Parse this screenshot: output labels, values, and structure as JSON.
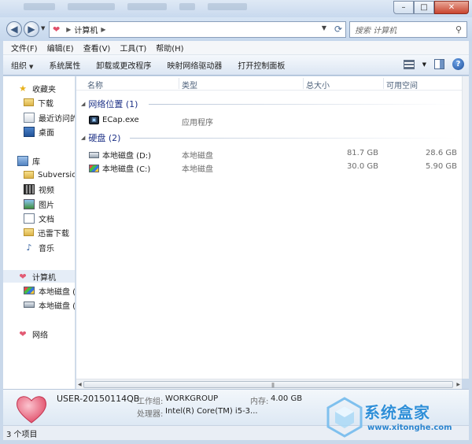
{
  "address": {
    "location": "计算机",
    "search_placeholder": "搜索 计算机"
  },
  "menu": [
    "文件(F)",
    "编辑(E)",
    "查看(V)",
    "工具(T)",
    "帮助(H)"
  ],
  "toolbar": {
    "organize": "组织",
    "system_properties": "系统属性",
    "uninstall": "卸载或更改程序",
    "map_drive": "映射网络驱动器",
    "control_panel": "打开控制面板"
  },
  "nav": {
    "favorites": "收藏夹",
    "downloads": "下载",
    "recent": "最近访问的",
    "desktop": "桌面",
    "libraries": "库",
    "subversion": "Subversion",
    "videos": "视频",
    "pictures": "图片",
    "documents": "文档",
    "thunder": "迅雷下载",
    "music": "音乐",
    "computer": "计算机",
    "disk_c": "本地磁盘 (C",
    "disk_d": "本地磁盘 (D",
    "network": "网络"
  },
  "columns": {
    "name": "名称",
    "type": "类型",
    "total": "总大小",
    "free": "可用空间"
  },
  "groups": {
    "network": {
      "header": "网络位置 (1)",
      "items": [
        {
          "name": "ECap.exe",
          "type": "应用程序",
          "total": "",
          "free": ""
        }
      ]
    },
    "disks": {
      "header": "硬盘 (2)",
      "items": [
        {
          "name": "本地磁盘 (D:)",
          "type": "本地磁盘",
          "total": "81.7 GB",
          "free": "28.6 GB"
        },
        {
          "name": "本地磁盘 (C:)",
          "type": "本地磁盘",
          "total": "30.0 GB",
          "free": "5.90 GB"
        }
      ]
    }
  },
  "details": {
    "computer_name": "USER-20150114QB",
    "workgroup_label": "工作组:",
    "workgroup": "WORKGROUP",
    "memory_label": "内存:",
    "memory": "4.00 GB",
    "processor_label": "处理器:",
    "processor": "Intel(R) Core(TM) i5-3..."
  },
  "status": {
    "item_count": "3 个项目"
  },
  "watermark": {
    "title": "系统盒家",
    "url": "www.xitonghe.com"
  },
  "colors": {
    "group_header": "#1e3287",
    "heart": "#e25b74",
    "watermark": "#2f8fd8"
  }
}
